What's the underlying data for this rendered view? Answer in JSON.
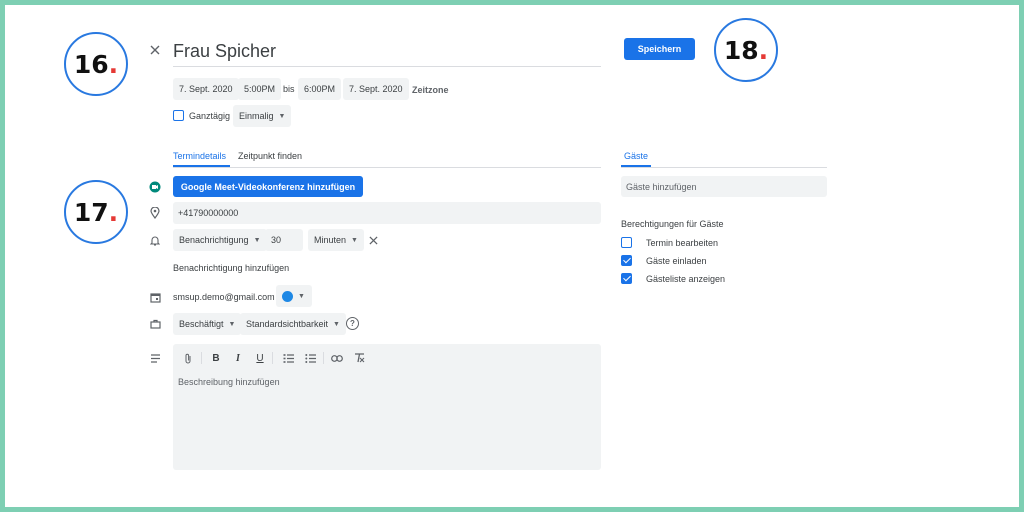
{
  "annotations": {
    "step16": "16",
    "step17": "17",
    "step18": "18",
    "dot": "."
  },
  "header": {
    "close_icon": "close-icon",
    "title": "Frau Spicher",
    "save_label": "Speichern",
    "start_date": "7. Sept. 2020",
    "start_time": "5:00PM",
    "bis": "bis",
    "end_time": "6:00PM",
    "end_date": "7. Sept. 2020",
    "timezone": "Zeitzone",
    "allday_label": "Ganztägig",
    "allday_checked": false,
    "repeat": "Einmalig"
  },
  "tabs": {
    "details": "Termindetails",
    "find_time": "Zeitpunkt finden",
    "guests": "Gäste"
  },
  "details": {
    "meet_button": "Google Meet-Videokonferenz hinzufügen",
    "location": "+41790000000",
    "notification_type": "Benachrichtigung",
    "notification_value": "30",
    "notification_unit": "Minuten",
    "add_notification": "Benachrichtigung hinzufügen",
    "calendar_owner": "smsup.demo@gmail.com",
    "calendar_color": "#1e88e5",
    "busy_status": "Beschäftigt",
    "visibility": "Standardsichtbarkeit",
    "help_icon": "?",
    "description_placeholder": "Beschreibung hinzufügen"
  },
  "toolbar": {
    "bold": "B",
    "italic": "I",
    "underline": "U"
  },
  "guests": {
    "add_placeholder": "Gäste hinzufügen",
    "permissions_title": "Berechtigungen für Gäste",
    "permissions": [
      {
        "label": "Termin bearbeiten",
        "checked": false
      },
      {
        "label": "Gäste einladen",
        "checked": true
      },
      {
        "label": "Gästeliste anzeigen",
        "checked": true
      }
    ]
  },
  "colors": {
    "accent": "#1a73e8",
    "frame": "#7ecfb3",
    "annotation_dot": "#e53935",
    "meet_green": "#00897b"
  }
}
